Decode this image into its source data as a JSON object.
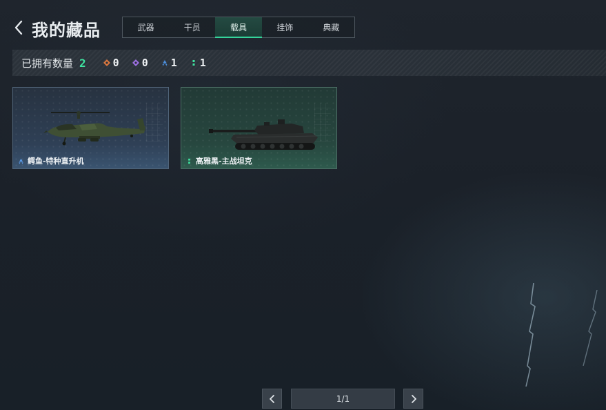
{
  "header": {
    "title": "我的藏品",
    "back_icon": "chevron-left-icon"
  },
  "tabs": [
    {
      "label": "武器",
      "active": false
    },
    {
      "label": "干员",
      "active": false
    },
    {
      "label": "载具",
      "active": true
    },
    {
      "label": "挂饰",
      "active": false
    },
    {
      "label": "典藏",
      "active": false
    }
  ],
  "stats": {
    "label": "已拥有数量",
    "total": "2",
    "rarities": [
      {
        "icon": "orange-diamond-rarity-icon",
        "color": "#d9773f",
        "count": "0"
      },
      {
        "icon": "purple-diamond-rarity-icon",
        "color": "#9b6fe0",
        "count": "0"
      },
      {
        "icon": "blue-triangle-rarity-icon",
        "color": "#4c8fdc",
        "count": "1"
      },
      {
        "icon": "green-dots-rarity-icon",
        "color": "#3fe2a0",
        "count": "1"
      }
    ]
  },
  "items": [
    {
      "name": "鳄鱼-特种直升机",
      "rarity": "blue",
      "rarity_icon": "blue-triangle-rarity-icon",
      "image": "helicopter"
    },
    {
      "name": "高雅黑-主战坦克",
      "rarity": "green",
      "rarity_icon": "green-dots-rarity-icon",
      "image": "tank"
    }
  ],
  "pagination": {
    "prev_icon": "chevron-left-icon",
    "next_icon": "chevron-right-icon",
    "label": "1/1"
  },
  "colors": {
    "accent": "#3fe2a0",
    "background": "#1c222a"
  }
}
